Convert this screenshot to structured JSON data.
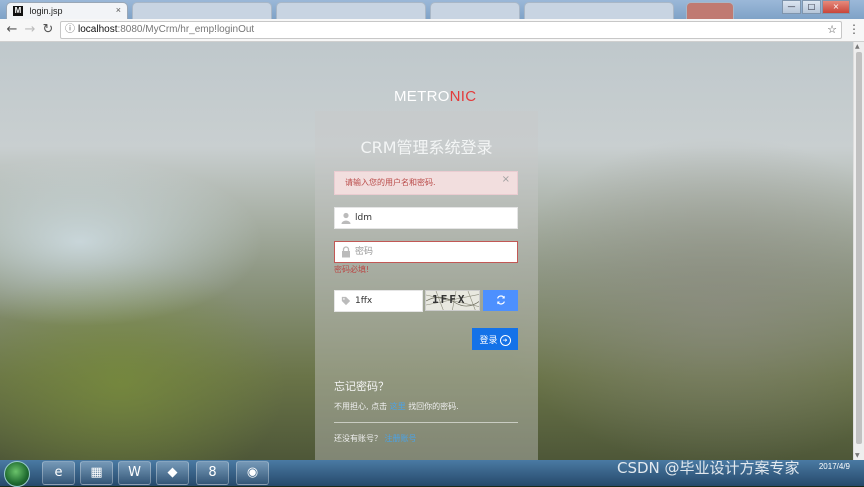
{
  "browser": {
    "tab_title": "login.jsp",
    "tab_favicon": "M",
    "tab_close": "×",
    "url_host": "localhost",
    "url_rest": ":8080/MyCrm/hr_emp!loginOut",
    "window_buttons": [
      "—",
      "□",
      "×"
    ]
  },
  "page": {
    "logo_metro": "METRO",
    "logo_nic": "NIC",
    "title": "CRM管理系统登录",
    "alert_text": "请输入您的用户名和密码.",
    "alert_close": "×",
    "username_value": "ldm",
    "password_placeholder": "密码",
    "password_error": "密码必填!",
    "captcha_value": "1ffx",
    "captcha_image_text": "1FFX",
    "login_label": "登录",
    "forget_title": "忘记密码？",
    "forget_text_before": "不用担心, 点击",
    "forget_link": "这里",
    "forget_text_after": "找回你的密码.",
    "register_text": "还没有账号？",
    "register_link": "注册账号"
  },
  "taskbar": {
    "time": "",
    "date": "2017/4/9",
    "watermark": "CSDN @毕业设计方案专家"
  },
  "colors": {
    "accent_blue": "#1472e8",
    "refresh_blue": "#4d90fe",
    "logo_red": "#e33b3b",
    "alert_bg": "#f2dede",
    "error_red": "#b94a48"
  }
}
